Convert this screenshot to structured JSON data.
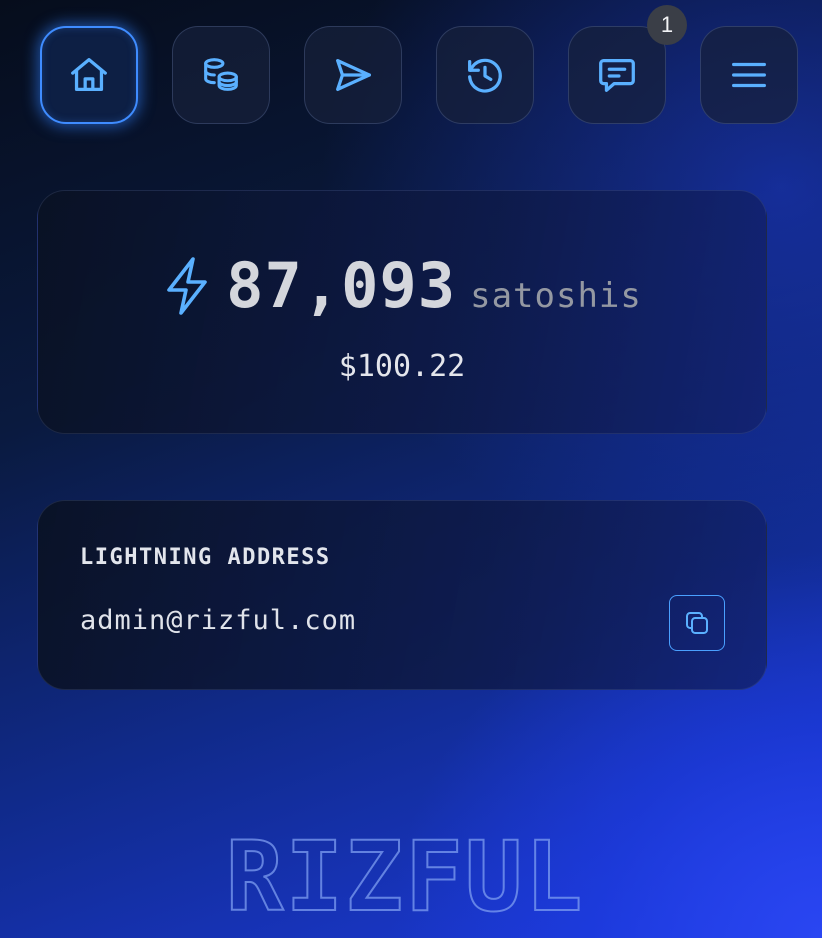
{
  "nav": {
    "items": [
      {
        "id": "home",
        "icon": "home-icon",
        "active": true
      },
      {
        "id": "coins",
        "icon": "coins-icon",
        "active": false
      },
      {
        "id": "send",
        "icon": "send-icon",
        "active": false
      },
      {
        "id": "history",
        "icon": "history-icon",
        "active": false
      },
      {
        "id": "messages",
        "icon": "message-icon",
        "active": false,
        "badge": "1"
      },
      {
        "id": "menu",
        "icon": "hamburger-menu-icon",
        "active": false
      }
    ]
  },
  "balance": {
    "amount": "87,093",
    "unit": "satoshis",
    "fiat": "$100.22"
  },
  "lightning": {
    "label": "LIGHTNING ADDRESS",
    "address": "admin@rizful.com"
  },
  "logo": {
    "text": "RIZFUL"
  },
  "colors": {
    "accent": "#3f8cff",
    "icon": "#5ab0ff",
    "badge": "#3a3e47"
  }
}
